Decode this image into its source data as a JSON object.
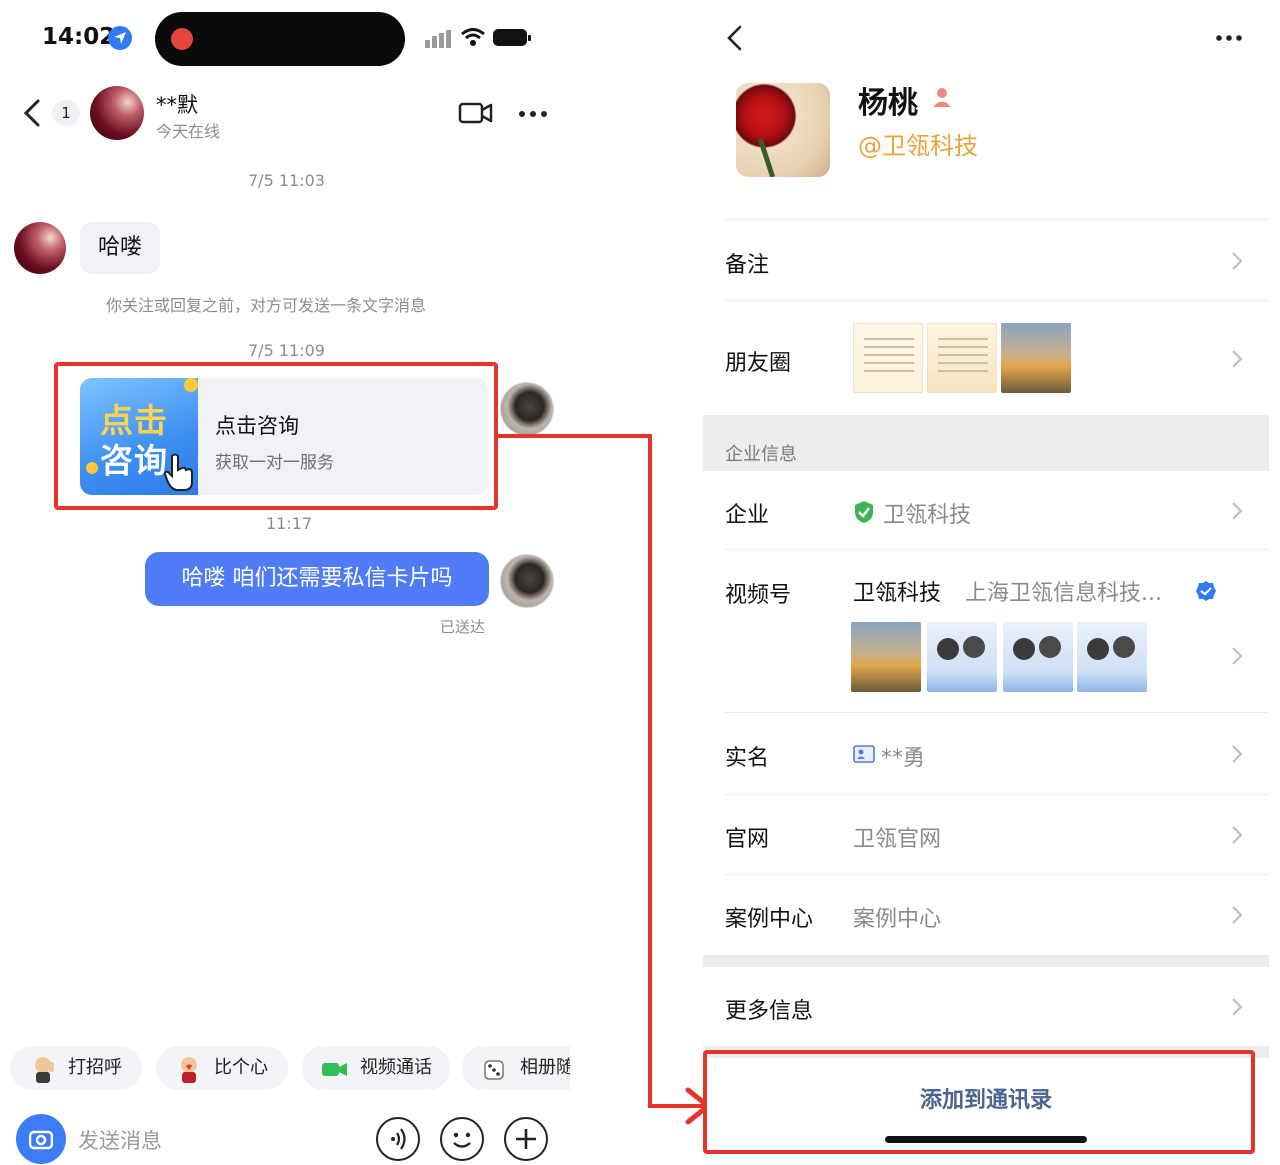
{
  "chat": {
    "status_time": "14:02",
    "unread_count": "1",
    "contact_name": "**默",
    "contact_status": "今天在线",
    "messages": {
      "time1": "7/5 11:03",
      "incoming_text": "哈喽",
      "system_note": "你关注或回复之前，对方可发送一条文字消息",
      "time2": "7/5 11:09",
      "card_thumb_line1": "点击",
      "card_thumb_line2": "咨询",
      "card_title": "点击咨询",
      "card_subtitle": "获取一对一服务",
      "time3": "11:17",
      "outgoing_text": "哈喽 咱们还需要私信卡片吗",
      "sent_status": "已送达"
    },
    "quick_actions": [
      {
        "label": "打招呼",
        "icon": "wave-emoji-icon"
      },
      {
        "label": "比个心",
        "icon": "heart-gesture-emoji-icon"
      },
      {
        "label": "视频通话",
        "icon": "video-call-icon"
      },
      {
        "label": "相册随",
        "icon": "dice-icon"
      }
    ],
    "input_placeholder": "发送消息",
    "colors": {
      "accent": "#4f7cf6",
      "highlight": "#e5342b"
    }
  },
  "profile": {
    "name": "杨桃",
    "org_handle": "@卫瓴科技",
    "rows": {
      "remark": "备注",
      "moments": "朋友圈",
      "section_enterprise": "企业信息",
      "enterprise_label": "企业",
      "enterprise_value": "卫瓴科技",
      "channels_label": "视频号",
      "channels_name": "卫瓴科技",
      "channels_company": "上海卫瓴信息科技...",
      "realname_label": "实名",
      "realname_value": "**勇",
      "website_label": "官网",
      "website_value": "卫瓴官网",
      "cases_label": "案例中心",
      "cases_value": "案例中心",
      "more_label": "更多信息"
    },
    "add_button": "添加到通讯录",
    "colors": {
      "org": "#e8a33a",
      "add_button_text": "#4a6491",
      "verified": "#2f7bf5"
    }
  }
}
